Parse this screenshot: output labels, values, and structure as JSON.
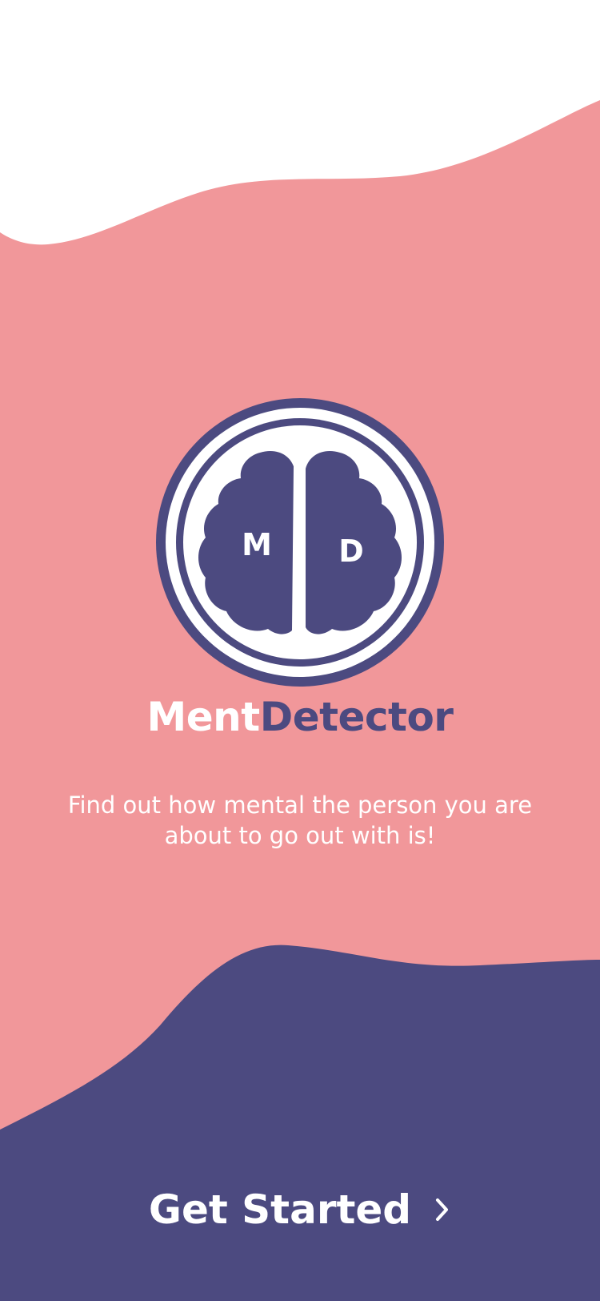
{
  "brand": {
    "logo_letter_left": "M",
    "logo_letter_right": "D",
    "name_part_1": "Ment",
    "name_part_2": "Detector"
  },
  "tagline": "Find out how mental the person you are about to go out with is!",
  "cta": {
    "label": "Get Started",
    "icon": "chevron-right-icon"
  },
  "colors": {
    "background_pink": "#F1979A",
    "top_wave_white": "#FFFFFF",
    "bottom_wave_purple": "#4C4A80",
    "brand_white": "#FFFFFF",
    "brand_purple": "#4C4A80"
  }
}
